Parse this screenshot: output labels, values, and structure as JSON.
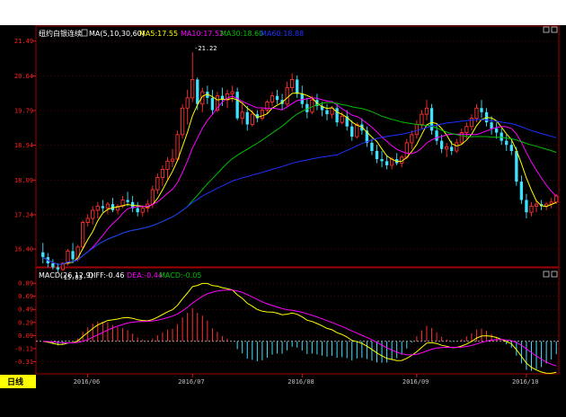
{
  "chart_data": [
    {
      "type": "candlestick",
      "symbol": "纽约白银连续",
      "indicator_label": "MA(5,10,30,60)",
      "ma_values": [
        {
          "label": "MA5:17.55",
          "color": "#ffff00"
        },
        {
          "label": "MA10:17.52",
          "color": "#ff00ff"
        },
        {
          "label": "MA30:18.60",
          "color": "#00c000"
        },
        {
          "label": "MA60:18.88",
          "color": "#2030ff"
        }
      ],
      "ylim": [
        16.05,
        21.55
      ],
      "y_ticks": [
        "21.49",
        "20.64",
        "19.79",
        "18.94",
        "18.09",
        "17.24",
        "16.40"
      ],
      "x_ticks": [
        {
          "label": "2016/06",
          "at": 9
        },
        {
          "label": "2016/07",
          "at": 30
        },
        {
          "label": "2016/08",
          "at": 52
        },
        {
          "label": "2016/09",
          "at": 75
        },
        {
          "label": "2016/10",
          "at": 97
        }
      ],
      "annotations": [
        {
          "text": "21.22",
          "index": 30
        },
        {
          "text": "15.83",
          "index": 3
        }
      ],
      "candles": [
        [
          16.32,
          16.55,
          16.05,
          16.2
        ],
        [
          16.2,
          16.3,
          15.95,
          16.05
        ],
        [
          16.05,
          16.15,
          15.9,
          15.95
        ],
        [
          15.95,
          16.05,
          15.83,
          15.9
        ],
        [
          15.9,
          16.08,
          15.86,
          16.05
        ],
        [
          16.05,
          16.4,
          16.0,
          16.35
        ],
        [
          16.35,
          16.55,
          16.05,
          16.15
        ],
        [
          16.15,
          16.5,
          16.1,
          16.45
        ],
        [
          16.45,
          17.1,
          16.4,
          17.05
        ],
        [
          17.05,
          17.25,
          16.95,
          17.15
        ],
        [
          17.15,
          17.45,
          17.0,
          17.35
        ],
        [
          17.35,
          17.55,
          17.15,
          17.45
        ],
        [
          17.45,
          17.6,
          17.3,
          17.4
        ],
        [
          17.4,
          17.55,
          17.25,
          17.5
        ],
        [
          17.5,
          17.65,
          17.3,
          17.35
        ],
        [
          17.35,
          17.5,
          17.25,
          17.45
        ],
        [
          17.45,
          17.7,
          17.4,
          17.6
        ],
        [
          17.6,
          17.8,
          17.45,
          17.55
        ],
        [
          17.55,
          17.7,
          17.3,
          17.4
        ],
        [
          17.4,
          17.55,
          17.2,
          17.3
        ],
        [
          17.3,
          17.45,
          17.2,
          17.4
        ],
        [
          17.4,
          17.6,
          17.3,
          17.5
        ],
        [
          17.5,
          17.95,
          17.4,
          17.85
        ],
        [
          17.85,
          18.25,
          17.75,
          18.15
        ],
        [
          18.15,
          18.45,
          17.95,
          18.35
        ],
        [
          18.35,
          18.65,
          18.1,
          18.55
        ],
        [
          18.55,
          18.85,
          18.4,
          18.6
        ],
        [
          18.6,
          19.3,
          18.55,
          19.2
        ],
        [
          19.2,
          19.95,
          19.1,
          19.85
        ],
        [
          19.85,
          20.3,
          19.45,
          20.1
        ],
        [
          20.1,
          21.22,
          20.0,
          20.55
        ],
        [
          20.55,
          20.6,
          19.8,
          19.95
        ],
        [
          19.95,
          20.35,
          19.75,
          20.25
        ],
        [
          20.25,
          20.4,
          19.95,
          20.1
        ],
        [
          20.1,
          20.3,
          19.7,
          19.8
        ],
        [
          19.8,
          20.25,
          19.75,
          20.15
        ],
        [
          20.15,
          20.35,
          19.9,
          20.05
        ],
        [
          20.05,
          20.3,
          19.85,
          20.2
        ],
        [
          20.2,
          20.4,
          20.0,
          20.25
        ],
        [
          20.25,
          20.35,
          19.55,
          19.6
        ],
        [
          19.6,
          19.95,
          19.45,
          19.75
        ],
        [
          19.75,
          19.9,
          19.3,
          19.45
        ],
        [
          19.45,
          19.8,
          19.4,
          19.7
        ],
        [
          19.7,
          19.8,
          19.5,
          19.6
        ],
        [
          19.6,
          19.85,
          19.55,
          19.8
        ],
        [
          19.8,
          20.05,
          19.7,
          20.0
        ],
        [
          20.0,
          20.25,
          19.9,
          20.15
        ],
        [
          20.15,
          20.3,
          19.95,
          20.05
        ],
        [
          20.05,
          20.2,
          19.8,
          19.95
        ],
        [
          19.95,
          20.5,
          19.9,
          20.35
        ],
        [
          20.35,
          20.7,
          20.25,
          20.55
        ],
        [
          20.55,
          20.65,
          20.1,
          20.2
        ],
        [
          20.2,
          20.4,
          19.85,
          19.95
        ],
        [
          19.95,
          20.1,
          19.6,
          19.75
        ],
        [
          19.75,
          20.15,
          19.7,
          20.05
        ],
        [
          20.05,
          20.2,
          19.8,
          19.9
        ],
        [
          19.9,
          20.0,
          19.65,
          19.8
        ],
        [
          19.8,
          19.95,
          19.55,
          19.7
        ],
        [
          19.7,
          19.9,
          19.6,
          19.85
        ],
        [
          19.85,
          19.95,
          19.4,
          19.5
        ],
        [
          19.5,
          19.75,
          19.45,
          19.65
        ],
        [
          19.65,
          19.8,
          19.3,
          19.4
        ],
        [
          19.4,
          19.55,
          19.05,
          19.15
        ],
        [
          19.15,
          19.5,
          19.1,
          19.45
        ],
        [
          19.45,
          19.6,
          19.2,
          19.3
        ],
        [
          19.3,
          19.4,
          18.9,
          19.0
        ],
        [
          19.0,
          19.1,
          18.7,
          18.8
        ],
        [
          18.8,
          18.95,
          18.5,
          18.6
        ],
        [
          18.6,
          18.8,
          18.4,
          18.55
        ],
        [
          18.55,
          18.7,
          18.35,
          18.45
        ],
        [
          18.45,
          18.65,
          18.35,
          18.6
        ],
        [
          18.6,
          18.75,
          18.45,
          18.5
        ],
        [
          18.5,
          18.7,
          18.4,
          18.65
        ],
        [
          18.65,
          19.1,
          18.6,
          19.0
        ],
        [
          19.0,
          19.3,
          18.85,
          19.2
        ],
        [
          19.2,
          19.55,
          19.1,
          19.45
        ],
        [
          19.45,
          19.8,
          19.35,
          19.7
        ],
        [
          19.7,
          20.05,
          19.55,
          19.85
        ],
        [
          19.85,
          19.95,
          19.2,
          19.3
        ],
        [
          19.3,
          19.45,
          18.95,
          19.05
        ],
        [
          19.05,
          19.2,
          18.75,
          18.85
        ],
        [
          18.85,
          19.0,
          18.65,
          18.9
        ],
        [
          18.9,
          19.05,
          18.7,
          18.8
        ],
        [
          18.8,
          19.1,
          18.75,
          19.0
        ],
        [
          19.0,
          19.35,
          18.95,
          19.25
        ],
        [
          19.25,
          19.5,
          19.1,
          19.4
        ],
        [
          19.4,
          19.7,
          19.3,
          19.6
        ],
        [
          19.6,
          19.95,
          19.5,
          19.85
        ],
        [
          19.85,
          20.05,
          19.6,
          19.75
        ],
        [
          19.75,
          19.85,
          19.4,
          19.5
        ],
        [
          19.5,
          19.65,
          19.2,
          19.35
        ],
        [
          19.35,
          19.5,
          19.1,
          19.25
        ],
        [
          19.25,
          19.35,
          18.95,
          19.05
        ],
        [
          19.05,
          19.2,
          18.8,
          18.95
        ],
        [
          18.95,
          19.05,
          18.7,
          18.8
        ],
        [
          18.8,
          18.9,
          17.95,
          18.05
        ],
        [
          18.05,
          18.2,
          17.5,
          17.6
        ],
        [
          17.6,
          17.75,
          17.15,
          17.3
        ],
        [
          17.3,
          17.55,
          17.2,
          17.45
        ],
        [
          17.45,
          17.6,
          17.3,
          17.5
        ],
        [
          17.5,
          17.6,
          17.35,
          17.45
        ],
        [
          17.45,
          17.55,
          17.35,
          17.5
        ],
        [
          17.5,
          17.65,
          17.4,
          17.55
        ],
        [
          17.55,
          17.75,
          17.5,
          17.7
        ]
      ]
    },
    {
      "type": "macd",
      "label": "MACD(26,12,9)",
      "values_text": [
        {
          "label": "DIFF:-0.46",
          "color": "#ffffff"
        },
        {
          "label": "DEA:-0.44",
          "color": "#ff00ff"
        },
        {
          "label": "MACD:-0.05",
          "color": "#00c000"
        }
      ],
      "ylim": [
        -0.47,
        0.92
      ],
      "y_ticks": [
        "0.89",
        "0.69",
        "0.49",
        "0.29",
        "0.09",
        "-0.11",
        "-0.31"
      ]
    }
  ],
  "period_label": "日线"
}
